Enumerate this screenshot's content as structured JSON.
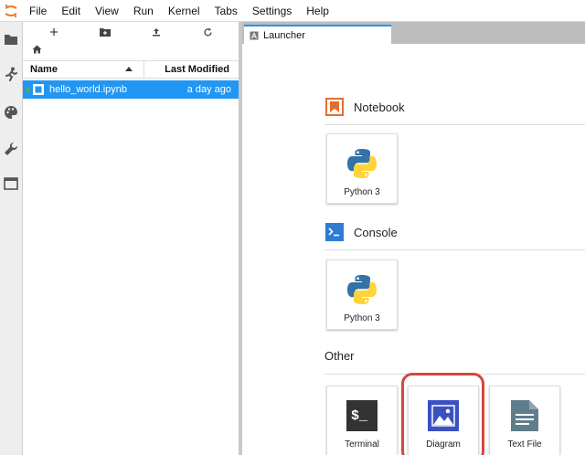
{
  "menubar": {
    "items": [
      "File",
      "Edit",
      "View",
      "Run",
      "Kernel",
      "Tabs",
      "Settings",
      "Help"
    ]
  },
  "rail": {
    "icons": [
      "folder-icon",
      "running-icon",
      "palette-icon",
      "wrench-icon",
      "tab-icon"
    ]
  },
  "filebrowser": {
    "header": {
      "name": "Name",
      "last_modified": "Last Modified"
    },
    "files": [
      {
        "name": "hello_world.ipynb",
        "modified": "a day ago",
        "selected": true,
        "running": true
      }
    ]
  },
  "tabs": [
    {
      "label": "Launcher",
      "active": true
    }
  ],
  "launcher": {
    "sections": [
      {
        "title": "Notebook",
        "items": [
          {
            "label": "Python 3",
            "icon": "python-icon"
          }
        ]
      },
      {
        "title": "Console",
        "items": [
          {
            "label": "Python 3",
            "icon": "python-icon"
          }
        ]
      },
      {
        "title": "Other",
        "items": [
          {
            "label": "Terminal",
            "icon": "terminal-icon"
          },
          {
            "label": "Diagram",
            "icon": "diagram-icon",
            "highlighted": true
          },
          {
            "label": "Text File",
            "icon": "text-file-icon"
          }
        ]
      }
    ]
  },
  "colors": {
    "accent": "#2196f3",
    "notebook_orange": "#e46e2e",
    "console_blue": "#2e7cd4",
    "diagram_blue": "#3b51c2",
    "highlight_red": "#d4473b"
  }
}
